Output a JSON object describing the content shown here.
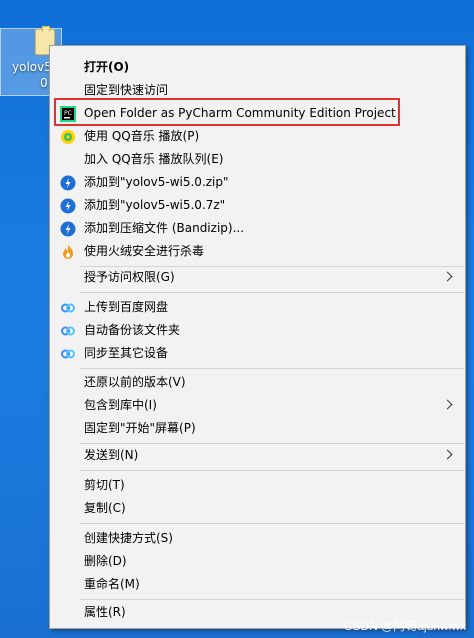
{
  "desktop": {
    "icon_label_line1": "yolov5",
    "icon_label_line2": "0"
  },
  "menu": [
    {
      "label": "打开(O)",
      "icon": "none",
      "bold": true
    },
    {
      "label": "固定到快速访问",
      "icon": "none"
    },
    {
      "label": "Open Folder as PyCharm Community Edition Project",
      "icon": "pycharm-icon"
    },
    {
      "label": "使用 QQ音乐 播放(P)",
      "icon": "qq-music-icon"
    },
    {
      "label": "加入 QQ音乐 播放队列(E)",
      "icon": "none"
    },
    {
      "label": "添加到\"yolov5-wi5.0.zip\"",
      "icon": "bandizip-icon"
    },
    {
      "label": "添加到\"yolov5-wi5.0.7z\"",
      "icon": "bandizip-icon"
    },
    {
      "label": "添加到压缩文件 (Bandizip)...",
      "icon": "bandizip-icon"
    },
    {
      "label": "使用火绒安全进行杀毒",
      "icon": "huorong-icon"
    },
    {
      "label": "授予访问权限(G)",
      "icon": "none",
      "submenu": true
    },
    {
      "label": "上传到百度网盘",
      "icon": "baidu-cloud-icon"
    },
    {
      "label": "自动备份该文件夹",
      "icon": "baidu-cloud-icon"
    },
    {
      "label": "同步至其它设备",
      "icon": "baidu-cloud-icon"
    },
    {
      "label": "还原以前的版本(V)",
      "icon": "none"
    },
    {
      "label": "包含到库中(I)",
      "icon": "none",
      "submenu": true
    },
    {
      "label": "固定到\"开始\"屏幕(P)",
      "icon": "none"
    },
    {
      "label": "发送到(N)",
      "icon": "none",
      "submenu": true
    },
    {
      "label": "剪切(T)",
      "icon": "none"
    },
    {
      "label": "复制(C)",
      "icon": "none"
    },
    {
      "label": "创建快捷方式(S)",
      "icon": "none"
    },
    {
      "label": "删除(D)",
      "icon": "none"
    },
    {
      "label": "重命名(M)",
      "icon": "none"
    },
    {
      "label": "属性(R)",
      "icon": "none"
    }
  ],
  "watermark": "CSDN @阿笱ajunwiwx",
  "colors": {
    "highlight": "#e0312d",
    "menu_bg": "#f2f2f2",
    "desktop": "#1a7be0"
  }
}
